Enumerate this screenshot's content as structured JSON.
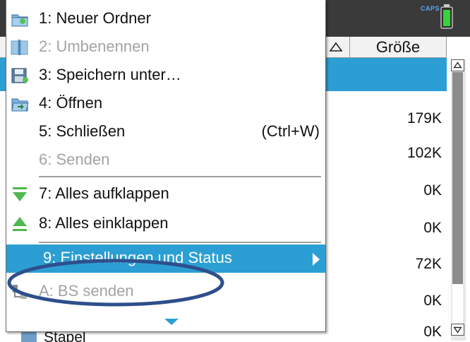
{
  "status": {
    "caps_label": "CAPS"
  },
  "file_list": {
    "size_header": "Größe",
    "sizes": [
      "179K",
      "102K",
      "0K",
      "0K",
      "72K",
      "0K",
      "0K"
    ],
    "partial_item": "Stapel"
  },
  "context_menu": {
    "items": [
      {
        "label": "1: Neuer Ordner",
        "icon": "new-folder-icon",
        "enabled": true
      },
      {
        "label": "2: Umbenennen",
        "icon": "rename-icon",
        "enabled": false
      },
      {
        "label": "3: Speichern unter…",
        "icon": "save-as-icon",
        "enabled": true
      },
      {
        "label": "4: Öffnen",
        "icon": "open-folder-icon",
        "enabled": true
      },
      {
        "label": "5: Schließen",
        "shortcut": "(Ctrl+W)",
        "enabled": true
      },
      {
        "label": "6: Senden",
        "enabled": false
      },
      {
        "label": "7: Alles aufklappen",
        "icon": "expand-all-icon",
        "enabled": true
      },
      {
        "label": "8: Alles einklappen",
        "icon": "collapse-all-icon",
        "enabled": true
      },
      {
        "label": "9: Einstellungen und Status",
        "enabled": true,
        "selected": true,
        "has_submenu": true
      },
      {
        "label": "A: BS senden",
        "icon": "send-os-icon",
        "enabled": false
      }
    ]
  },
  "colors": {
    "accent": "#2b9fd3",
    "highlight_ellipse": "#2e4f8c",
    "disabled_text": "#a3a3a3"
  }
}
